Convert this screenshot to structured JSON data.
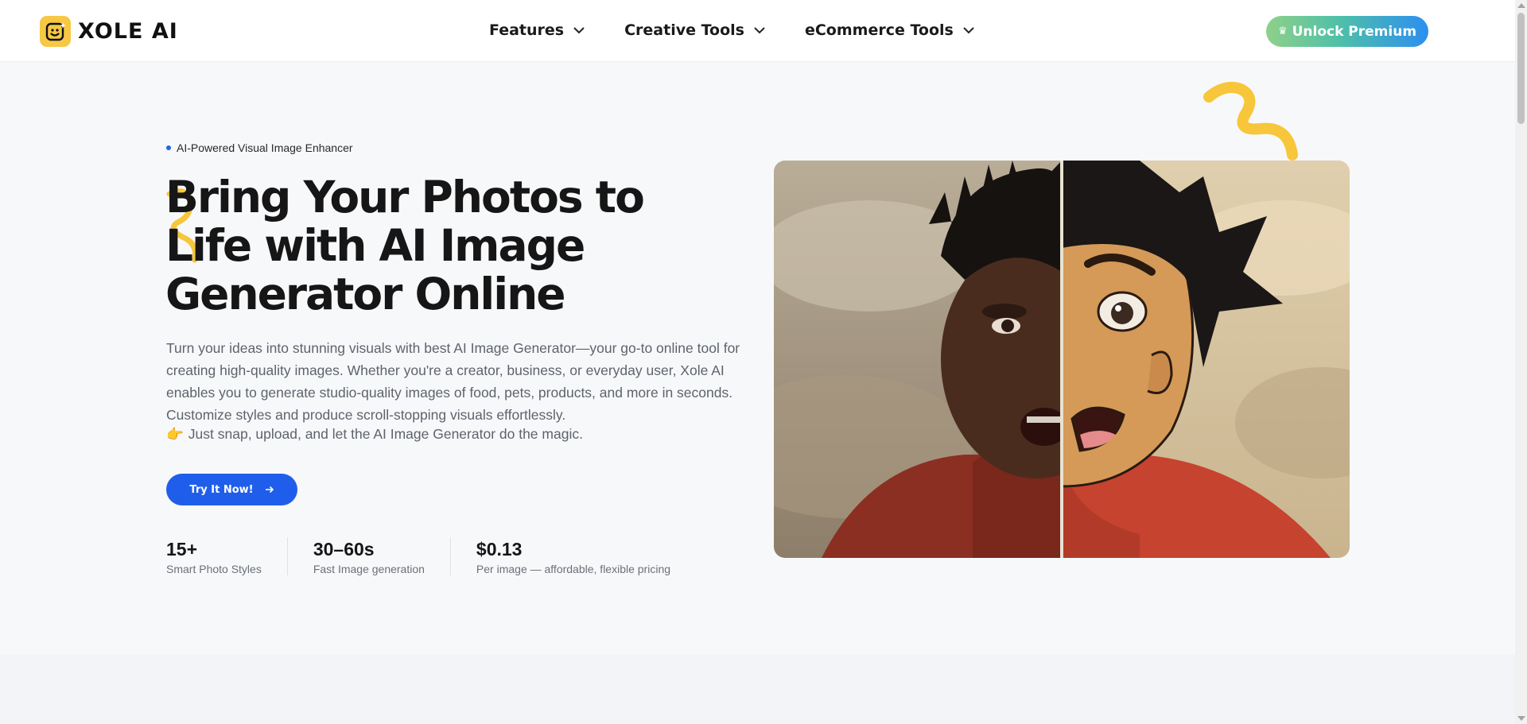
{
  "brand": {
    "name": "XOLE AI"
  },
  "nav": {
    "items": [
      {
        "label": "Features"
      },
      {
        "label": "Creative Tools"
      },
      {
        "label": "eCommerce Tools"
      }
    ],
    "premium_label": "Unlock Premium"
  },
  "hero": {
    "eyebrow": "AI-Powered Visual Image Enhancer",
    "headline": "Bring Your Photos to Life with AI Image Generator Online",
    "description": "Turn your ideas into stunning visuals with best AI Image Generator—your go-to online tool for creating high-quality images. Whether you're a creator, business, or everyday user, Xole AI enables you to generate studio-quality images of food, pets, products, and more in seconds. Customize styles and produce scroll-stopping visuals effortlessly.",
    "tip": "Just snap, upload, and let the AI Image Generator do the magic.",
    "tip_emoji": "👉",
    "cta_label": "Try It Now!",
    "stats": [
      {
        "value": "15+",
        "label": "Smart Photo Styles"
      },
      {
        "value": "30–60s",
        "label": "Fast Image generation"
      },
      {
        "value": "$0.13",
        "label": "Per image — affordable, flexible pricing"
      }
    ]
  },
  "colors": {
    "accent": "#1f5eea",
    "brand_yellow": "#f7c844",
    "premium_gradient": [
      "#8fd08a",
      "#4fc0a8",
      "#2d8ff0"
    ]
  },
  "icons": [
    "chevron-down-icon",
    "crown-icon",
    "arrow-right-icon",
    "squiggle-decoration"
  ]
}
